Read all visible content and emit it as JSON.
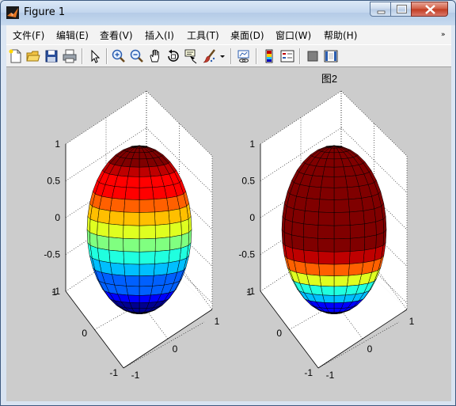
{
  "window": {
    "title": "Figure 1",
    "buttons": [
      "minimize-button",
      "maximize-button",
      "close-button"
    ]
  },
  "menubar": {
    "items": [
      {
        "label": "文件(F)"
      },
      {
        "label": "编辑(E)"
      },
      {
        "label": "查看(V)"
      },
      {
        "label": "插入(I)"
      },
      {
        "label": "工具(T)"
      },
      {
        "label": "桌面(D)"
      },
      {
        "label": "窗口(W)"
      },
      {
        "label": "帮助(H)"
      }
    ],
    "overflow_arrow": "»"
  },
  "toolbar": {
    "icons": [
      "new-figure-icon",
      "open-file-icon",
      "save-icon",
      "print-icon",
      "select-arrow-icon",
      "zoom-in-icon",
      "zoom-out-icon",
      "pan-hand-icon",
      "rotate-3d-icon",
      "data-cursor-icon",
      "brush-icon",
      "brush-dropdown-icon",
      "link-plot-icon",
      "colorbar-icon",
      "legend-icon",
      "hide-plot-tools-icon",
      "show-plot-tools-icon"
    ]
  },
  "axes_left": {
    "title": "",
    "z_ticks": [
      "1",
      "0.5",
      "0",
      "-0.5",
      "-1"
    ],
    "y_ticks": [
      "1",
      "0",
      "-1"
    ],
    "x_ticks": [
      "-1",
      "0",
      "1"
    ],
    "colormap": "jet"
  },
  "axes_right": {
    "title": "图2",
    "z_ticks": [
      "1",
      "0.5",
      "0",
      "-0.5",
      "-1"
    ],
    "y_ticks": [
      "1",
      "0",
      "-1"
    ],
    "x_ticks": [
      "-1",
      "0",
      "1"
    ],
    "colormap": "jet-saturated"
  },
  "colors": {
    "figure_bg": "#cccccc",
    "axes_bg": "#ffffff",
    "jet": [
      "#00008f",
      "#0000ff",
      "#0060ff",
      "#00bfff",
      "#20ffdf",
      "#80ff80",
      "#dfff20",
      "#ffbf00",
      "#ff6000",
      "#ff0000",
      "#bf0000",
      "#800000"
    ]
  }
}
